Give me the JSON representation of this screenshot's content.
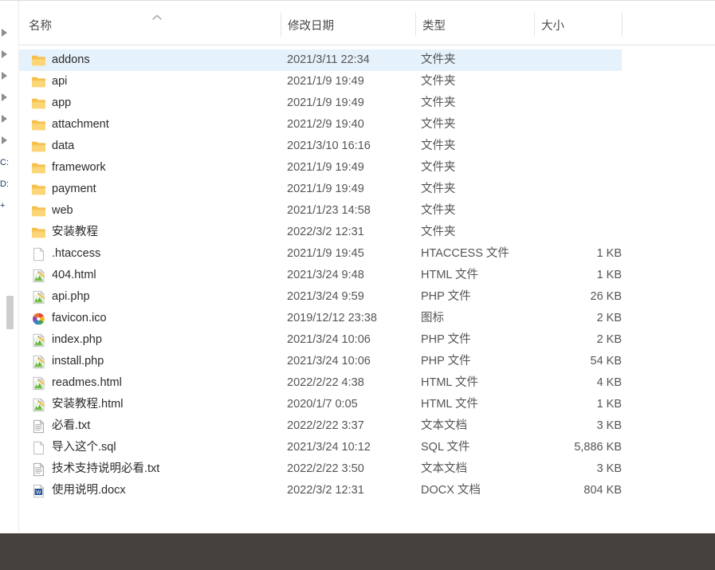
{
  "window": {
    "title": "File Explorer Details View",
    "selection_color": "#e5f1fb",
    "bottom_bar_color": "#46413f"
  },
  "columns": {
    "name": {
      "label": "名称",
      "sort": "ascending",
      "sort_icon": "chevron-up-icon"
    },
    "date": {
      "label": "修改日期"
    },
    "type": {
      "label": "类型"
    },
    "size": {
      "label": "大小"
    }
  },
  "nav_tree": {
    "nodes": [
      {
        "icon": "chevron-right-icon"
      },
      {
        "icon": "chevron-right-icon"
      },
      {
        "icon": "chevron-right-icon"
      },
      {
        "icon": "chevron-right-icon"
      },
      {
        "icon": "chevron-right-icon"
      },
      {
        "icon": "chevron-right-icon"
      },
      {
        "glyph": "C:"
      },
      {
        "glyph": "D:"
      },
      {
        "glyph": "+"
      }
    ]
  },
  "rows": [
    {
      "name": "addons",
      "date": "2021/3/11 22:34",
      "type": "文件夹",
      "size": "",
      "icon": "folder-icon",
      "selected": true
    },
    {
      "name": "api",
      "date": "2021/1/9 19:49",
      "type": "文件夹",
      "size": "",
      "icon": "folder-icon",
      "selected": false
    },
    {
      "name": "app",
      "date": "2021/1/9 19:49",
      "type": "文件夹",
      "size": "",
      "icon": "folder-icon",
      "selected": false
    },
    {
      "name": "attachment",
      "date": "2021/2/9 19:40",
      "type": "文件夹",
      "size": "",
      "icon": "folder-icon",
      "selected": false
    },
    {
      "name": "data",
      "date": "2021/3/10 16:16",
      "type": "文件夹",
      "size": "",
      "icon": "folder-icon",
      "selected": false
    },
    {
      "name": "framework",
      "date": "2021/1/9 19:49",
      "type": "文件夹",
      "size": "",
      "icon": "folder-icon",
      "selected": false
    },
    {
      "name": "payment",
      "date": "2021/1/9 19:49",
      "type": "文件夹",
      "size": "",
      "icon": "folder-icon",
      "selected": false
    },
    {
      "name": "web",
      "date": "2021/1/23 14:58",
      "type": "文件夹",
      "size": "",
      "icon": "folder-icon",
      "selected": false
    },
    {
      "name": "安装教程",
      "date": "2022/3/2 12:31",
      "type": "文件夹",
      "size": "",
      "icon": "folder-icon",
      "selected": false
    },
    {
      "name": ".htaccess",
      "date": "2021/1/9 19:45",
      "type": "HTACCESS 文件",
      "size": "1 KB",
      "icon": "blank-document-icon",
      "selected": false
    },
    {
      "name": "404.html",
      "date": "2021/3/24 9:48",
      "type": "HTML 文件",
      "size": "1 KB",
      "icon": "html-editor-icon",
      "selected": false
    },
    {
      "name": "api.php",
      "date": "2021/3/24 9:59",
      "type": "PHP 文件",
      "size": "26 KB",
      "icon": "html-editor-icon",
      "selected": false
    },
    {
      "name": "favicon.ico",
      "date": "2019/12/12 23:38",
      "type": "图标",
      "size": "2 KB",
      "icon": "favicon-pinwheel-icon",
      "selected": false
    },
    {
      "name": "index.php",
      "date": "2021/3/24 10:06",
      "type": "PHP 文件",
      "size": "2 KB",
      "icon": "html-editor-icon",
      "selected": false
    },
    {
      "name": "install.php",
      "date": "2021/3/24 10:06",
      "type": "PHP 文件",
      "size": "54 KB",
      "icon": "html-editor-icon",
      "selected": false
    },
    {
      "name": "readmes.html",
      "date": "2022/2/22 4:38",
      "type": "HTML 文件",
      "size": "4 KB",
      "icon": "html-editor-icon",
      "selected": false
    },
    {
      "name": "安装教程.html",
      "date": "2020/1/7 0:05",
      "type": "HTML 文件",
      "size": "1 KB",
      "icon": "html-editor-icon",
      "selected": false
    },
    {
      "name": "必看.txt",
      "date": "2022/2/22 3:37",
      "type": "文本文档",
      "size": "3 KB",
      "icon": "text-document-icon",
      "selected": false
    },
    {
      "name": "导入这个.sql",
      "date": "2021/3/24 10:12",
      "type": "SQL 文件",
      "size": "5,886 KB",
      "icon": "blank-document-icon",
      "selected": false
    },
    {
      "name": "技术支持说明必看.txt",
      "date": "2022/2/22 3:50",
      "type": "文本文档",
      "size": "3 KB",
      "icon": "text-document-icon",
      "selected": false
    },
    {
      "name": "使用说明.docx",
      "date": "2022/3/2 12:31",
      "type": "DOCX 文档",
      "size": "804 KB",
      "icon": "word-document-icon",
      "selected": false
    }
  ]
}
